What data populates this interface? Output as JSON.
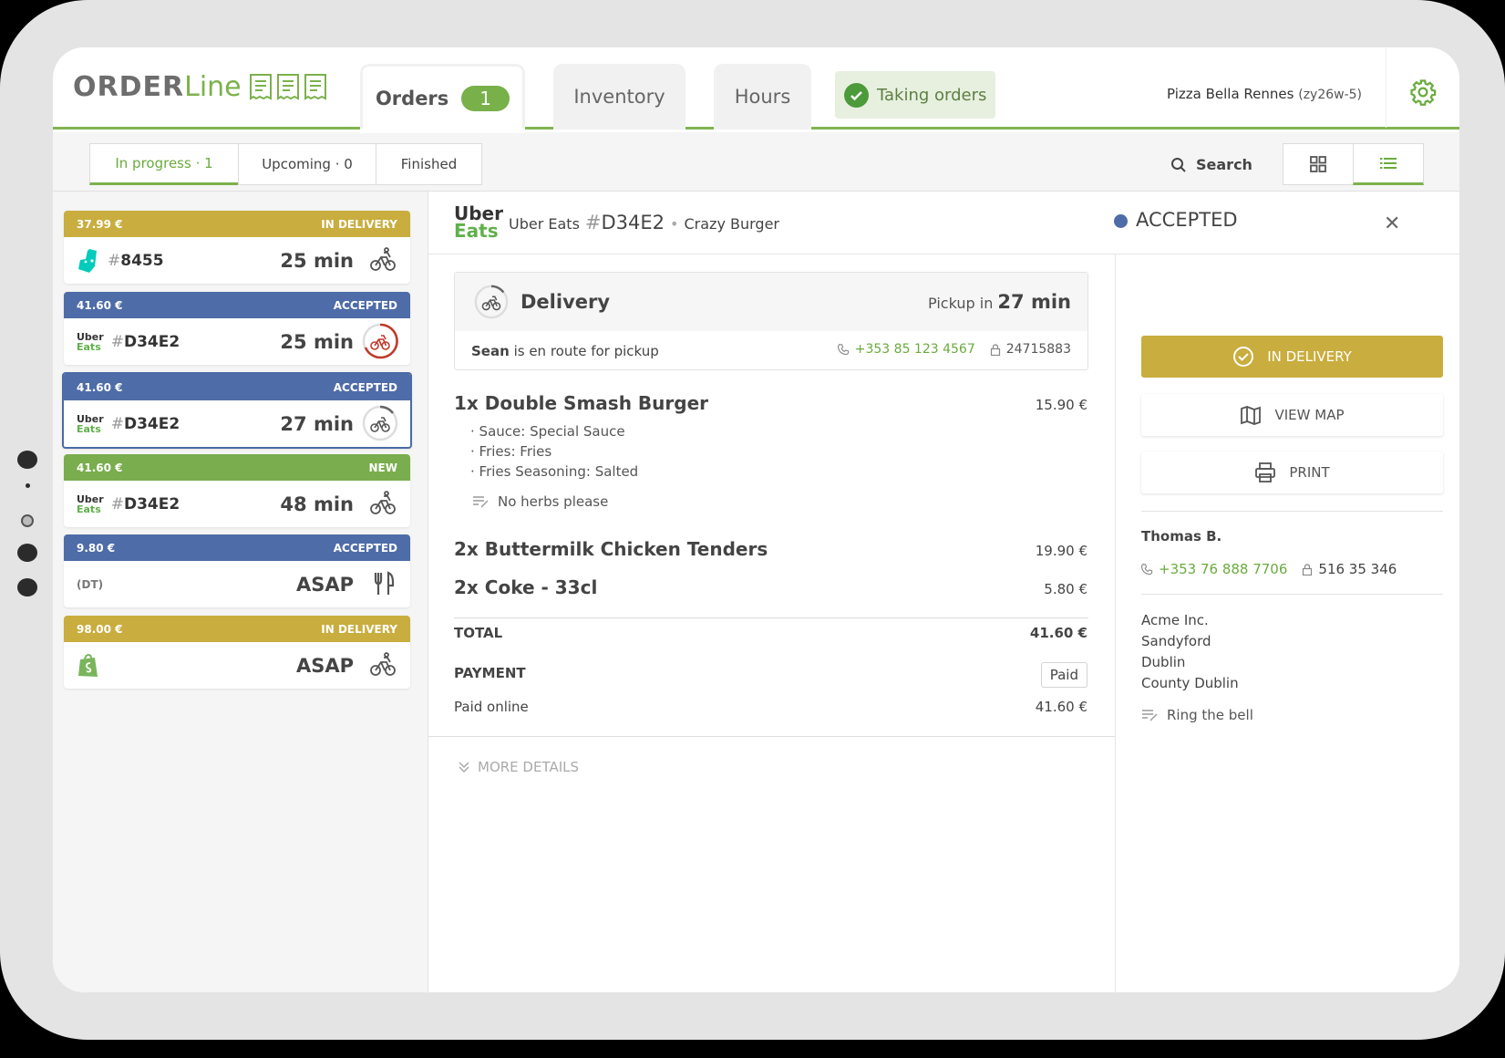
{
  "app": {
    "logo_order": "ORDER",
    "logo_line": "Line"
  },
  "tabs": [
    {
      "label": "Orders",
      "count": "1"
    },
    {
      "label": "Inventory"
    },
    {
      "label": "Hours"
    }
  ],
  "taking_orders": "Taking orders",
  "store": {
    "name": "Pizza Bella Rennes",
    "code": "(zy26w-5)"
  },
  "filters": [
    {
      "label": "In progress · 1"
    },
    {
      "label": "Upcoming · 0"
    },
    {
      "label": "Finished"
    }
  ],
  "search_label": "Search",
  "orders": [
    {
      "price": "37.99 €",
      "status": "IN DELIVERY",
      "id": "8455",
      "hash": "#",
      "time": "25 min",
      "color": "gold",
      "source": "deliveroo",
      "icon": "bike-icon"
    },
    {
      "price": "41.60 €",
      "status": "ACCEPTED",
      "id": "D34E2",
      "hash": "#",
      "time": "25 min",
      "color": "blue",
      "source": "uber",
      "icon": "bike-timer-red-icon"
    },
    {
      "price": "41.60 €",
      "status": "ACCEPTED",
      "id": "D34E2",
      "hash": "#",
      "time": "27 min",
      "color": "blue",
      "source": "uber",
      "icon": "bike-timer-icon"
    },
    {
      "price": "41.60 €",
      "status": "NEW",
      "id": "D34E2",
      "hash": "#",
      "time": "48 min",
      "color": "green",
      "source": "uber",
      "icon": "bike-icon"
    },
    {
      "price": "9.80 €",
      "status": "ACCEPTED",
      "id": "(DT)",
      "time": "ASAP",
      "color": "blue",
      "source": "dine-in",
      "icon": "fork-knife-icon"
    },
    {
      "price": "98.00 €",
      "status": "IN DELIVERY",
      "id": "",
      "time": "ASAP",
      "color": "gold",
      "source": "shopify",
      "icon": "bike-icon"
    }
  ],
  "uber_logo": {
    "line1": "Uber",
    "line2": "Eats"
  },
  "detail": {
    "platform": "Uber Eats",
    "hash": "#",
    "id": "D34E2",
    "restaurant": "Crazy Burger",
    "status": "ACCEPTED",
    "delivery_title": "Delivery",
    "pickup_prefix": "Pickup in",
    "pickup_time": "27 min",
    "courier_name": "Sean",
    "courier_text": "is en route for pickup",
    "courier_phone": "+353 85 123 4567",
    "courier_code": "24715883",
    "items": [
      {
        "title": "1x Double Smash Burger",
        "price": "15.90 €",
        "mods": [
          "Sauce: Special Sauce",
          "Fries: Fries",
          "Fries Seasoning: Salted"
        ],
        "note": "No herbs please"
      },
      {
        "title": "2x Buttermilk Chicken Tenders",
        "price": "19.90 €"
      },
      {
        "title": "2x Coke - 33cl",
        "price": "5.80 €"
      }
    ],
    "total_label": "TOTAL",
    "total": "41.60 €",
    "payment_label": "PAYMENT",
    "payment_badge": "Paid",
    "paid_online_label": "Paid online",
    "paid_online": "41.60 €",
    "more_details": "MORE DETAILS"
  },
  "actions": {
    "in_delivery": "IN DELIVERY",
    "view_map": "VIEW MAP",
    "print": "PRINT"
  },
  "customer": {
    "name": "Thomas B.",
    "phone": "+353 76 888 7706",
    "code": "516 35 346",
    "address": [
      "Acme Inc.",
      "Sandyford",
      "Dublin",
      "County Dublin"
    ],
    "note": "Ring the bell"
  },
  "colors": {
    "gold": "#c9ad3e",
    "blue": "#4e6ca8",
    "green": "#79ad4d",
    "accent": "#7cb14c"
  }
}
